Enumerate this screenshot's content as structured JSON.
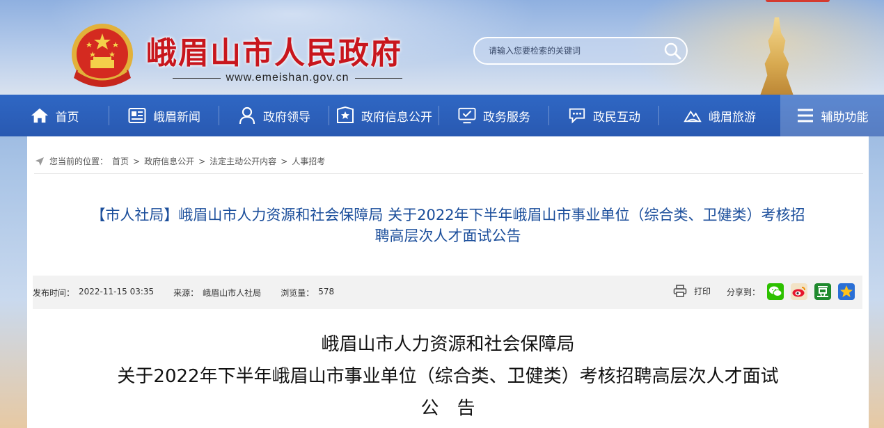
{
  "header": {
    "site_title": "峨眉山市人民政府",
    "site_url": "www.emeishan.gov.cn",
    "search_placeholder": "请输入您要检索的关键词"
  },
  "nav": {
    "items": [
      {
        "label": "首页",
        "icon": "home-icon"
      },
      {
        "label": "峨眉新闻",
        "icon": "news-icon"
      },
      {
        "label": "政府领导",
        "icon": "person-icon"
      },
      {
        "label": "政府信息公开",
        "icon": "star-document-icon"
      },
      {
        "label": "政务服务",
        "icon": "monitor-icon"
      },
      {
        "label": "政民互动",
        "icon": "chat-icon"
      },
      {
        "label": "峨眉旅游",
        "icon": "mountain-icon"
      },
      {
        "label": "辅助功能",
        "icon": "menu-icon"
      }
    ]
  },
  "breadcrumb": {
    "prefix": "您当前的位置：",
    "items": [
      "首页",
      "政府信息公开",
      "法定主动公开内容",
      "人事招考"
    ],
    "separator": ">"
  },
  "article": {
    "headline_line1": "【市人社局】峨眉山市人力资源和社会保障局 关于2022年下半年峨眉山市事业单位（综合类、卫健类）考核招",
    "headline_line2": "聘高层次人才面试公告",
    "meta": {
      "publish_label": "发布时间：",
      "publish_value": "2022-11-15 03:35",
      "source_label": "来源：",
      "source_value": "峨眉山市人社局",
      "views_label": "浏览量：",
      "views_value": "578"
    },
    "print_label": "打印",
    "share_label": "分享到：",
    "share_targets": [
      "wechat-icon",
      "weibo-icon",
      "douban-icon",
      "qzone-icon"
    ],
    "body_title_line1": "峨眉山市人力资源和社会保障局",
    "body_title_line2": "关于2022年下半年峨眉山市事业单位（综合类、卫健类）考核招聘高层次人才面试",
    "body_title_line3": "公　告"
  },
  "colors": {
    "nav_blue": "#2f67c4",
    "title_red": "#c8161d",
    "headline_blue": "#1b4e9b"
  }
}
